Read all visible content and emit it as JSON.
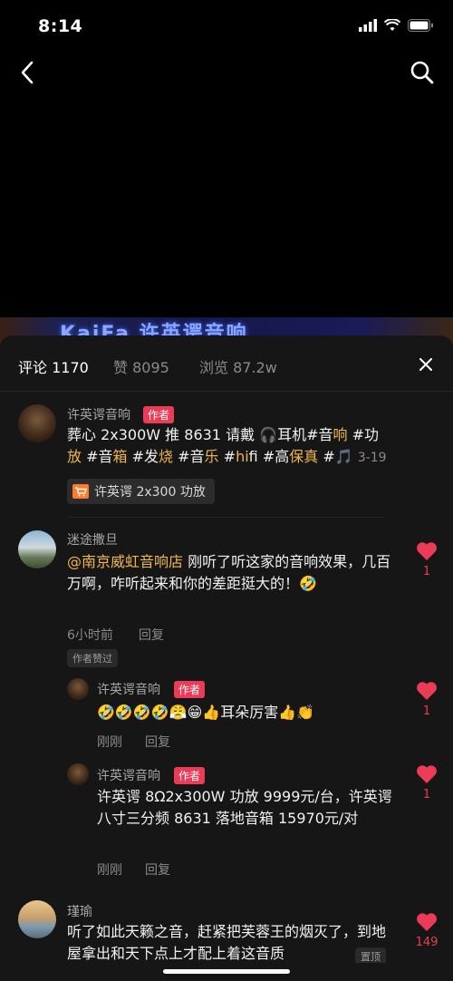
{
  "status_bar": {
    "time": "8:14"
  },
  "video": {
    "banner_text": "KaiFa 许英谔音响"
  },
  "sheet": {
    "tabs": [
      {
        "label": "评论 1170"
      },
      {
        "label": "赞 8095"
      },
      {
        "label": "浏览 87.2w"
      }
    ]
  },
  "comments": [
    {
      "author": "许英谔音响",
      "author_badge": "作者",
      "text_parts": [
        "葬心 2x300W 推 8631 请戴 ",
        "耳机#音",
        "响",
        " #功",
        "放",
        " #音",
        "箱",
        " #发",
        "烧",
        " #音",
        "乐",
        " #",
        "hi",
        "fi #高",
        "保真",
        " #🎵 "
      ],
      "date": "3-19",
      "product_chip": "许英谔 2x300 功放"
    },
    {
      "author": "迷途撒旦",
      "mention": "@南京威虹音响店",
      "text": " 刚听了听这家的音响效果，几百万啊，咋听起来和你的差距挺大的！🤣",
      "time": "6小时前",
      "reply_label": "回复",
      "author_liked": "作者赞过",
      "likes": "1"
    },
    {
      "author": "许英谔音响",
      "author_badge": "作者",
      "text": "🤣🤣🤣🤣😤😁👍耳朵厉害👍👏",
      "time": "刚刚",
      "reply_label": "回复",
      "likes": "1"
    },
    {
      "author": "许英谔音响",
      "author_badge": "作者",
      "text": "许英谔 8Ω2x300W 功放 9999元/台，许英谔八寸三分频 8631 落地音箱 15970元/对",
      "time": "刚刚",
      "reply_label": "回复",
      "likes": "1"
    },
    {
      "author": "瑾瑜",
      "text": "听了如此天籁之音，赶紧把芙蓉王的烟灭了，到地屋拿出和天下点上才配上着这音质",
      "pinned_label": "置顶",
      "likes": "149"
    }
  ],
  "colors": {
    "accent": "#f0b54b",
    "like": "#ec3b56",
    "sheet_bg": "#161616"
  }
}
